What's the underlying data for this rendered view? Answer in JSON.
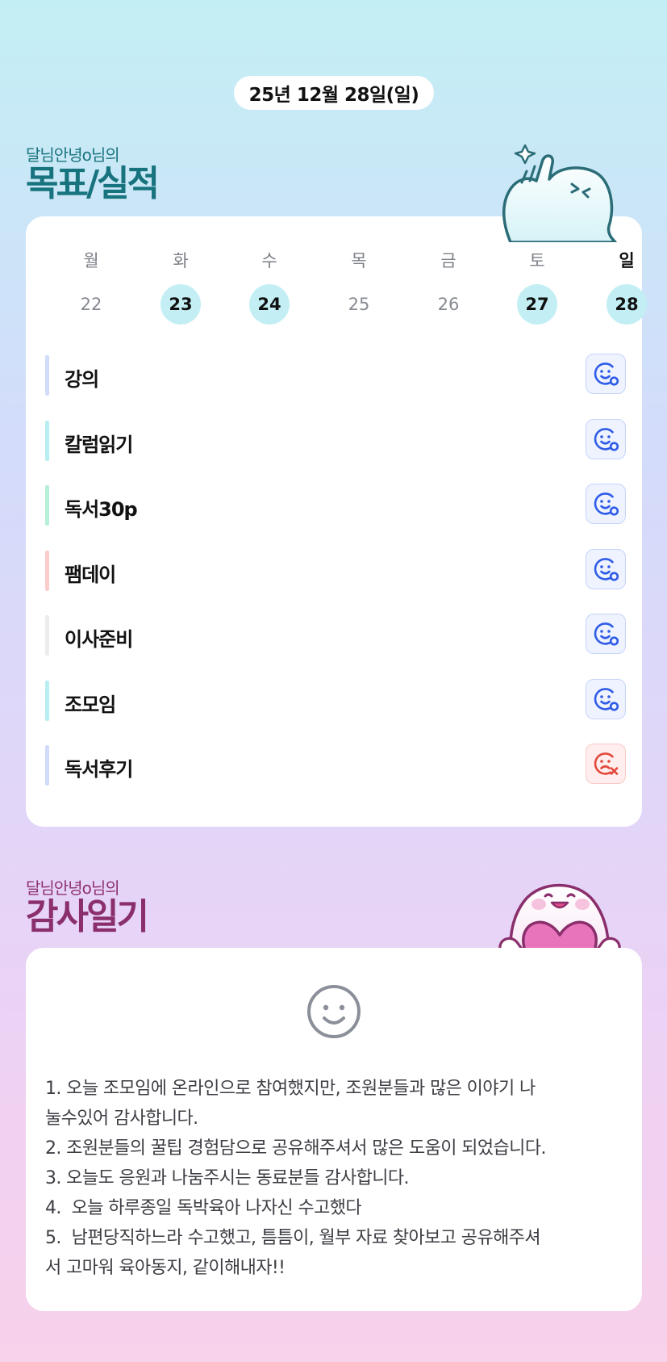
{
  "header": {
    "date": "25년 12월 28일(일)"
  },
  "goals_section": {
    "owner": "달님안녕o님의",
    "title": "목표/실적"
  },
  "week": [
    {
      "name": "월",
      "num": "22",
      "done": false,
      "today": false
    },
    {
      "name": "화",
      "num": "23",
      "done": true,
      "today": false
    },
    {
      "name": "수",
      "num": "24",
      "done": true,
      "today": false
    },
    {
      "name": "목",
      "num": "25",
      "done": false,
      "today": false
    },
    {
      "name": "금",
      "num": "26",
      "done": false,
      "today": false
    },
    {
      "name": "토",
      "num": "27",
      "done": true,
      "today": false
    },
    {
      "name": "일",
      "num": "28",
      "done": true,
      "today": true
    }
  ],
  "goals": [
    {
      "label": "강의",
      "color": "#d1dcfb",
      "status": "achieved"
    },
    {
      "label": "칼럼읽기",
      "color": "#b8eff2",
      "status": "achieved"
    },
    {
      "label": "독서30p",
      "color": "#b5f0d8",
      "status": "achieved"
    },
    {
      "label": "팸데이",
      "color": "#fccdca",
      "status": "achieved"
    },
    {
      "label": "이사준비",
      "color": "#ececec",
      "status": "achieved"
    },
    {
      "label": "조모임",
      "color": "#b8eff2",
      "status": "achieved"
    },
    {
      "label": "독서후기",
      "color": "#d1dcfb",
      "status": "failed"
    }
  ],
  "status_icons": {
    "achieved": "smile-check-icon",
    "failed": "sad-x-icon"
  },
  "thanks_section": {
    "owner": "달님안녕o님의",
    "title": "감사일기",
    "body": "1. 오늘 조모임에 온라인으로 참여했지만, 조원분들과 많은 이야기 나\n눌수있어 감사합니다.\n2. 조원분들의 꿀팁 경험담으로 공유해주셔서 많은 도움이 되었습니다.\n3. 오늘도 응원과 나눔주시는 동료분들 감사합니다.\n4.  오늘 하루종일 독박육아 나자신 수고했다\n5.  남편당직하느라 수고했고, 틈틈이, 월부 자료 찾아보고 공유해주셔\n서 고마워 육아동지, 같이해내자!!"
  },
  "colors": {
    "goals_title": "#17737d",
    "thanks_title": "#8a2f6c",
    "done_day": "#c3eff4",
    "achieved_icon": "#2f5ce6",
    "failed_icon": "#e2483c"
  }
}
